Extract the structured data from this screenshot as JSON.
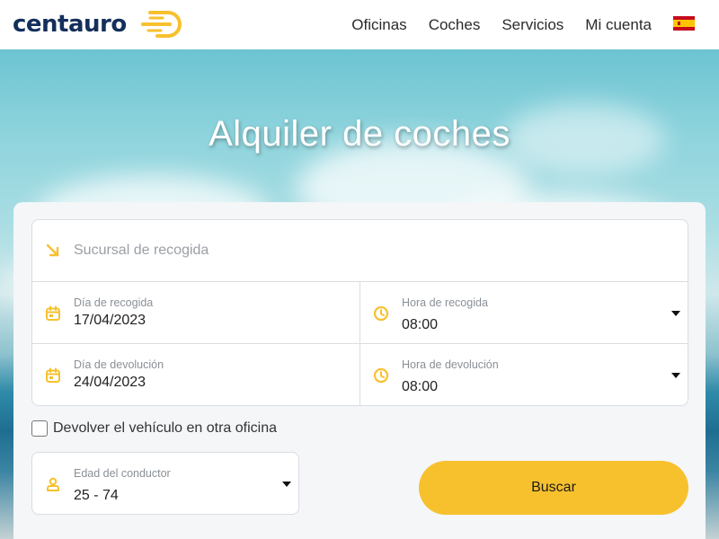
{
  "brand": {
    "name": "centauro",
    "color": "#142f5c",
    "accent": "#f7c12e"
  },
  "nav": {
    "items": [
      "Oficinas",
      "Coches",
      "Servicios",
      "Mi cuenta"
    ],
    "language_flag": "spain-flag"
  },
  "hero": {
    "title": "Alquiler de coches"
  },
  "search": {
    "pickup_branch": {
      "placeholder": "Sucursal de recogida",
      "icon": "arrow-down-right-icon"
    },
    "pickup_date": {
      "label": "Día de recogida",
      "value": "17/04/2023",
      "icon": "calendar-icon"
    },
    "pickup_time": {
      "label": "Hora de recogida",
      "value": "08:00",
      "icon": "clock-icon"
    },
    "return_date": {
      "label": "Día de devolución",
      "value": "24/04/2023",
      "icon": "calendar-icon"
    },
    "return_time": {
      "label": "Hora de devolución",
      "value": "08:00",
      "icon": "clock-icon"
    },
    "different_return": {
      "label": "Devolver el vehículo en otra oficina",
      "checked": false
    },
    "driver_age": {
      "label": "Edad del conductor",
      "value": "25 - 74",
      "icon": "person-icon"
    },
    "submit_label": "Buscar"
  }
}
